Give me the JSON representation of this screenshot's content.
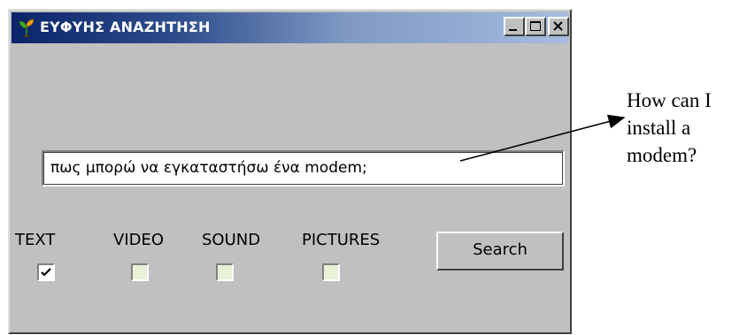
{
  "window": {
    "title": "ΕΥΦΥΗΣ ΑΝΑΖΗΤΗΣΗ",
    "controls": [
      "minimize",
      "maximize",
      "close"
    ]
  },
  "search": {
    "value": "πως μπορώ να εγκαταστήσω ένα modem;"
  },
  "filters": [
    {
      "label": "TEXT",
      "checked": true
    },
    {
      "label": "VIDEO",
      "checked": false
    },
    {
      "label": "SOUND",
      "checked": false
    },
    {
      "label": "PICTURES",
      "checked": false
    }
  ],
  "buttons": {
    "search_label": "Search"
  },
  "annotation": {
    "lines": [
      "How can I",
      "install a",
      "modem?"
    ]
  },
  "colors": {
    "window_bg": "#c0c0c0",
    "titlebar_start": "#0a246a",
    "titlebar_end": "#a6bcdf",
    "checkbox_bg": "#e8f0d8"
  },
  "icons": {
    "app": "sprout-icon",
    "checkmark": "check-icon"
  }
}
